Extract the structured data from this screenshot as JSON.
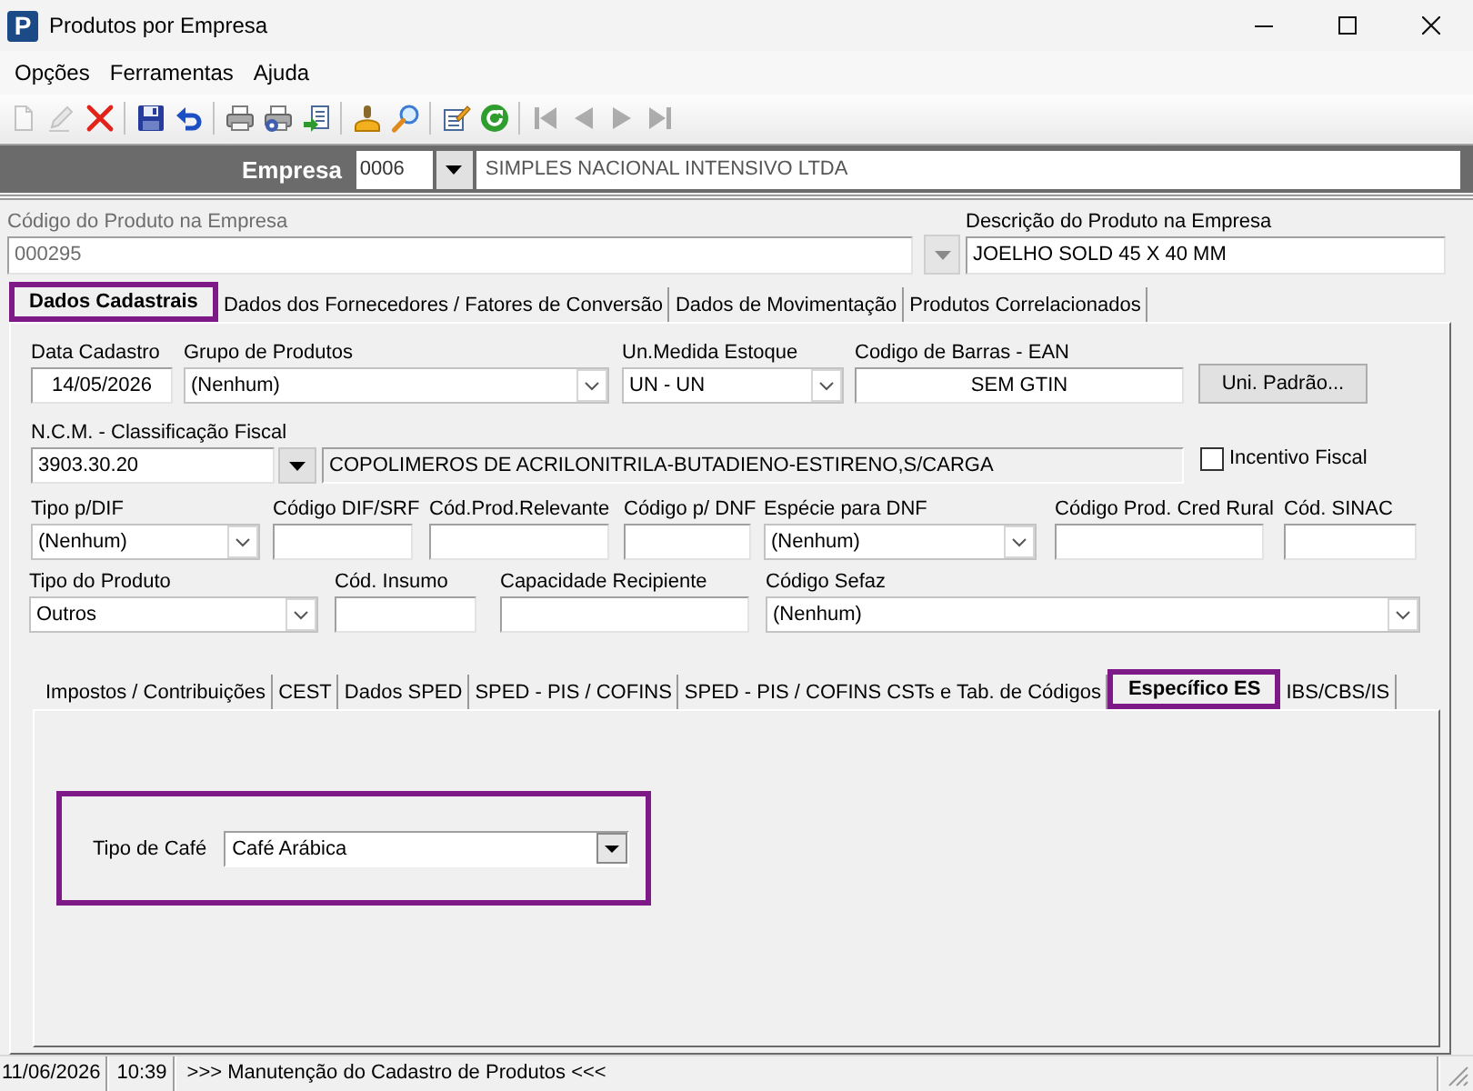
{
  "window": {
    "logo": "P",
    "title": "Produtos por Empresa"
  },
  "menu": [
    "Opções",
    "Ferramentas",
    "Ajuda"
  ],
  "toolbar": [
    [
      {
        "disabled": true
      },
      {
        "disabled": true
      },
      {
        "disabled": false
      }
    ],
    [
      {
        "disabled": false
      },
      {
        "disabled": false
      }
    ],
    [
      {
        "disabled": false
      },
      {
        "disabled": false
      },
      {
        "disabled": false
      }
    ],
    [
      {
        "disabled": false
      },
      {
        "disabled": false
      }
    ],
    [
      {
        "disabled": false
      },
      {
        "disabled": false
      }
    ],
    [
      {
        "disabled": true
      },
      {
        "disabled": true
      },
      {
        "disabled": true
      },
      {
        "disabled": true
      }
    ]
  ],
  "company": {
    "label": "Empresa",
    "code": "0006",
    "name": "SIMPLES NACIONAL INTENSIVO LTDA"
  },
  "product": {
    "code": {
      "label": "Código do Produto na Empresa",
      "value": "000295",
      "disabled": true
    },
    "description": {
      "label": "Descrição do Produto na Empresa",
      "value": "JOELHO SOLD 45 X 40 MM"
    }
  },
  "tabs": [
    {
      "label": "Dados Cadastrais",
      "selected": true,
      "highlighted": true
    },
    {
      "label": "Dados dos Fornecedores / Fatores de Conversão",
      "selected": false,
      "highlighted": false
    },
    {
      "label": "Dados de Movimentação",
      "selected": false,
      "highlighted": false
    },
    {
      "label": "Produtos Correlacionados",
      "selected": false,
      "highlighted": false
    }
  ],
  "form": {
    "field_lines": [
      {
        "fields": [
          {
            "kind": "text",
            "label": "Data Cadastro",
            "value": "14/05/2026"
          },
          {
            "kind": "combo",
            "label": "Grupo de Produtos",
            "value": "(Nenhum)"
          },
          {
            "kind": "combo",
            "label": "Un.Medida Estoque",
            "value": "UN - UN"
          },
          {
            "kind": "text",
            "label": "Codigo de Barras - EAN",
            "value": "SEM GTIN"
          },
          {
            "kind": "button",
            "label": "Uni. Padrão..."
          }
        ]
      },
      {
        "fields": [
          {
            "kind": "lookup",
            "label": "N.C.M. - Classificação Fiscal",
            "value": "3903.30.20"
          },
          {
            "kind": "readonly",
            "value": "COPOLIMEROS DE ACRILONITRILA-BUTADIENO-ESTIRENO,S/CARGA"
          },
          {
            "kind": "checkbox",
            "label": "Incentivo Fiscal",
            "checked": false
          }
        ]
      },
      {
        "fields": [
          {
            "kind": "combo",
            "label": "Tipo p/DIF",
            "value": "(Nenhum)"
          },
          {
            "kind": "text",
            "label": "Código DIF/SRF"
          },
          {
            "kind": "text",
            "label": "Cód.Prod.Relevante"
          },
          {
            "kind": "text",
            "label": "Código p/ DNF"
          },
          {
            "kind": "combo",
            "label": "Espécie para DNF",
            "value": "(Nenhum)"
          },
          {
            "kind": "text",
            "label": "Código Prod. Cred Rural"
          },
          {
            "kind": "text",
            "label": "Cód. SINAC"
          }
        ]
      },
      {
        "fields": [
          {
            "kind": "combo",
            "label": "Tipo do Produto",
            "value": "Outros"
          },
          {
            "kind": "text",
            "label": "Cód. Insumo"
          },
          {
            "kind": "text",
            "label": "Capacidade Recipiente"
          },
          {
            "kind": "combo",
            "label": "Código Sefaz",
            "value": "(Nenhum)"
          }
        ]
      }
    ]
  },
  "subtabs": [
    {
      "label": "Impostos / Contribuições",
      "selected": false,
      "highlighted": false
    },
    {
      "label": "CEST",
      "selected": false,
      "highlighted": false
    },
    {
      "label": "Dados SPED",
      "selected": false,
      "highlighted": false
    },
    {
      "label": "SPED - PIS / COFINS",
      "selected": false,
      "highlighted": false
    },
    {
      "label": "SPED - PIS / COFINS CSTs e Tab. de Códigos",
      "selected": false,
      "highlighted": false
    },
    {
      "label": "Específico ES",
      "selected": true,
      "highlighted": true
    },
    {
      "label": "IBS/CBS/IS",
      "selected": false,
      "highlighted": false
    }
  ],
  "specific": {
    "highlighted": true,
    "label": "Tipo de Café",
    "value": "Café Arábica"
  },
  "status_bar": [
    "11/06/2026",
    "10:39",
    ">>> Manutenção do Cadastro de Produtos <<<"
  ]
}
